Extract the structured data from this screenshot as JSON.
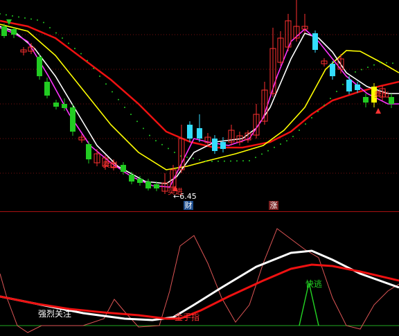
{
  "price_panel": {
    "low_marker_text": "←6.45",
    "sell_signal_1": "卖出",
    "buy_signal_text": "买进",
    "sell_signal_2": "卖出",
    "colors": {
      "up_candle": "#ff3030",
      "down_candle_cyan": "#33ddff",
      "down_candle_green": "#22cc22",
      "ma_white": "#ffffff",
      "ma_yellow": "#ffff00",
      "ma_magenta": "#ff33ff",
      "ma_red": "#ee1111",
      "dots_green": "#22cc22",
      "grid": "#7a1010"
    }
  },
  "event_badges": {
    "finance": "财",
    "limit_up": "涨"
  },
  "indicator_panel": {
    "label_focus": "强烈关注",
    "label_golden_finger": "金手指",
    "label_quick_exit": "快逃",
    "colors": {
      "white_line": "#ffffff",
      "red_line": "#ee1111",
      "thin_line": "#dd5555",
      "green_spike": "#22cc22",
      "baseline": "#22aa22"
    }
  }
}
